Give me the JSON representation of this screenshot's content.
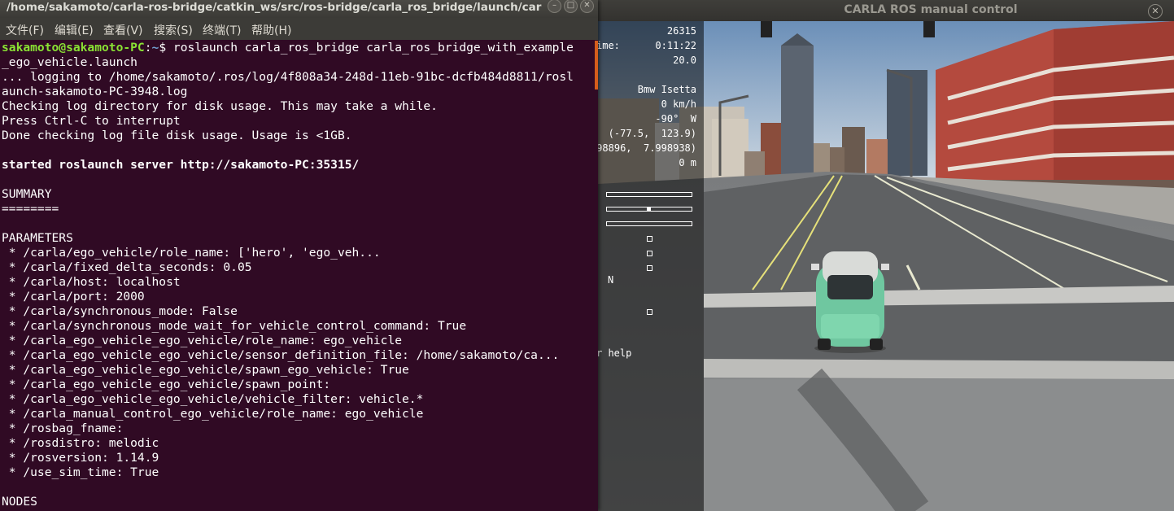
{
  "carla": {
    "window_title": "CARLA ROS manual control",
    "close_glyph": "✕",
    "hud": {
      "server_fps": "26315",
      "sim_time_label": "ime:",
      "sim_time": "0:11:22",
      "client_fps": "20.0",
      "vehicle": "Bmw Isetta",
      "speed": "0 km/h",
      "heading": "-90°  W",
      "location": "(-77.5,  123.9)",
      "gnss": "98896,  7.998938)",
      "height": "0 m",
      "steer_indicator": 0.5,
      "gear": "N",
      "help": "r help"
    }
  },
  "terminal": {
    "title": "/home/sakamoto/carla-ros-bridge/catkin_ws/src/ros-bridge/carla_ros_bridge/launch/carla_r...",
    "window_buttons": {
      "close": "✕",
      "minimize": "–",
      "maximize": "□"
    },
    "menus": [
      "文件(F)",
      "编辑(E)",
      "查看(V)",
      "搜索(S)",
      "终端(T)",
      "帮助(H)"
    ],
    "prompt_user": "sakamoto@sakamoto-PC",
    "prompt_sep": ":",
    "prompt_path": "~",
    "prompt_dollar": "$ ",
    "command": "roslaunch carla_ros_bridge carla_ros_bridge_with_example",
    "lines": [
      "_ego_vehicle.launch",
      "... logging to /home/sakamoto/.ros/log/4f808a34-248d-11eb-91bc-dcfb484d8811/rosl",
      "aunch-sakamoto-PC-3948.log",
      "Checking log directory for disk usage. This may take a while.",
      "Press Ctrl-C to interrupt",
      "Done checking log file disk usage. Usage is <1GB.",
      "",
      "started roslaunch server http://sakamoto-PC:35315/",
      "",
      "SUMMARY",
      "========",
      "",
      "PARAMETERS",
      " * /carla/ego_vehicle/role_name: ['hero', 'ego_veh...",
      " * /carla/fixed_delta_seconds: 0.05",
      " * /carla/host: localhost",
      " * /carla/port: 2000",
      " * /carla/synchronous_mode: False",
      " * /carla/synchronous_mode_wait_for_vehicle_control_command: True",
      " * /carla_ego_vehicle_ego_vehicle/role_name: ego_vehicle",
      " * /carla_ego_vehicle_ego_vehicle/sensor_definition_file: /home/sakamoto/ca...",
      " * /carla_ego_vehicle_ego_vehicle/spawn_ego_vehicle: True",
      " * /carla_ego_vehicle_ego_vehicle/spawn_point: ",
      " * /carla_ego_vehicle_ego_vehicle/vehicle_filter: vehicle.*",
      " * /carla_manual_control_ego_vehicle/role_name: ego_vehicle",
      " * /rosbag_fname: ",
      " * /rosdistro: melodic",
      " * /rosversion: 1.14.9",
      " * /use_sim_time: True",
      "",
      "NODES"
    ]
  }
}
